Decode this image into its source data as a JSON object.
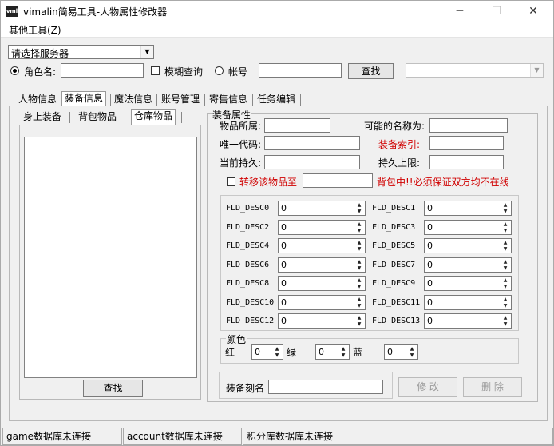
{
  "window": {
    "title": "vimalin简易工具-人物属性修改器",
    "icon_text": "vml"
  },
  "controls": {
    "minimize": "─",
    "maximize": "☐",
    "close": "✕"
  },
  "menu": {
    "other_tools": "其他工具(Z)"
  },
  "server": {
    "selected": "请选择服务器"
  },
  "search_bar": {
    "role_name_label": "角色名:",
    "role_name_value": "",
    "fuzzy_label": "模糊查询",
    "account_label": "帐号",
    "account_value": "",
    "search_button": "查找",
    "result_value": ""
  },
  "tabs": [
    "人物信息",
    "装备信息",
    "魔法信息",
    "账号管理",
    "寄售信息",
    "任务编辑"
  ],
  "sub_tabs": [
    "身上装备",
    "背包物品",
    "仓库物品"
  ],
  "left_panel": {
    "search_button": "查找",
    "items": []
  },
  "equip": {
    "group_title": "装备属性",
    "owner_label": "物品所属:",
    "owner_value": "",
    "possible_name_label": "可能的名称为:",
    "possible_name_value": "",
    "unique_code_label": "唯一代码:",
    "unique_code_value": "",
    "index_label": "装备索引:",
    "index_value": "",
    "durability_label": "当前持久:",
    "durability_value": "",
    "max_durability_label": "持久上限:",
    "max_durability_value": "",
    "transfer_label": "转移该物品至",
    "transfer_value": "",
    "transfer_note": "背包中!!必须保证双方均不在线"
  },
  "fld_desc": [
    {
      "left_label": "FLD_DESC0",
      "left_value": "0",
      "right_label": "FLD_DESC1",
      "right_value": "0"
    },
    {
      "left_label": "FLD_DESC2",
      "left_value": "0",
      "right_label": "FLD_DESC3",
      "right_value": "0"
    },
    {
      "left_label": "FLD_DESC4",
      "left_value": "0",
      "right_label": "FLD_DESC5",
      "right_value": "0"
    },
    {
      "left_label": "FLD_DESC6",
      "left_value": "0",
      "right_label": "FLD_DESC7",
      "right_value": "0"
    },
    {
      "left_label": "FLD_DESC8",
      "left_value": "0",
      "right_label": "FLD_DESC9",
      "right_value": "0"
    },
    {
      "left_label": "FLD_DESC10",
      "left_value": "0",
      "right_label": "FLD_DESC11",
      "right_value": "0"
    },
    {
      "left_label": "FLD_DESC12",
      "left_value": "0",
      "right_label": "FLD_DESC13",
      "right_value": "0"
    }
  ],
  "color": {
    "group_title": "颜色",
    "red_label": "红",
    "red_value": "0",
    "green_label": "绿",
    "green_value": "0",
    "blue_label": "蓝",
    "blue_value": "0"
  },
  "engrave": {
    "label": "装备刻名",
    "value": ""
  },
  "actions": {
    "modify": "修 改",
    "delete": "删 除"
  },
  "status": {
    "game_db": "game数据库未连接",
    "account_db": "account数据库未连接",
    "points_db": "积分库数据库未连接"
  },
  "palette": {
    "error_red": "#d00000",
    "title_bg": "#ffffff",
    "window_bg": "#f0f0f0"
  }
}
